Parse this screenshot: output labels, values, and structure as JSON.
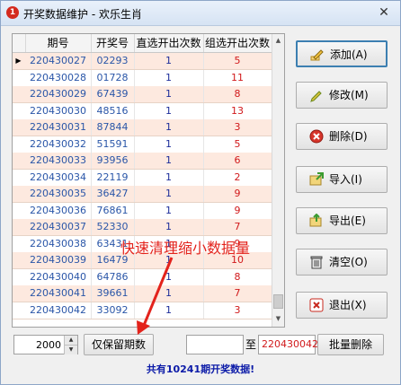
{
  "window": {
    "title": "开奖数据维护 - 欢乐生肖",
    "close_glyph": "✕",
    "app_icon_glyph": "❶"
  },
  "table": {
    "columns": [
      "期号",
      "开奖号",
      "直选开出次数",
      "组选开出次数"
    ],
    "current_row_marker": "▶",
    "rows": [
      [
        "220430027",
        "02293",
        "1",
        "5"
      ],
      [
        "220430028",
        "01728",
        "1",
        "11"
      ],
      [
        "220430029",
        "67439",
        "1",
        "8"
      ],
      [
        "220430030",
        "48516",
        "1",
        "13"
      ],
      [
        "220430031",
        "87844",
        "1",
        "3"
      ],
      [
        "220430032",
        "51591",
        "1",
        "5"
      ],
      [
        "220430033",
        "93956",
        "1",
        "6"
      ],
      [
        "220430034",
        "22119",
        "1",
        "2"
      ],
      [
        "220430035",
        "36427",
        "1",
        "9"
      ],
      [
        "220430036",
        "76861",
        "1",
        "9"
      ],
      [
        "220430037",
        "52330",
        "1",
        "7"
      ],
      [
        "220430038",
        "63431",
        "1",
        "9"
      ],
      [
        "220430039",
        "16479",
        "1",
        "10"
      ],
      [
        "220430040",
        "64786",
        "1",
        "8"
      ],
      [
        "220430041",
        "39661",
        "1",
        "7"
      ],
      [
        "220430042",
        "33092",
        "1",
        "3"
      ]
    ]
  },
  "buttons": {
    "add": "添加(A)",
    "edit": "修改(M)",
    "delete": "删除(D)",
    "import": "导入(I)",
    "export": "导出(E)",
    "clear": "清空(O)",
    "exit": "退出(X)"
  },
  "bottom": {
    "keep_count": "2000",
    "keep_button": "仅保留期数",
    "from_value": "",
    "to_label": "至",
    "to_value": "220430042",
    "batch_delete_button": "批量删除",
    "status": "共有10241期开奖数据!"
  },
  "annotation": {
    "text": "快速清理缩小数据量",
    "color": "#e3231c"
  },
  "colors": {
    "odd_row": "#fde9df",
    "period_text": "#2a56a8",
    "group_text": "#d1191b",
    "status_text": "#0c1ba8"
  }
}
